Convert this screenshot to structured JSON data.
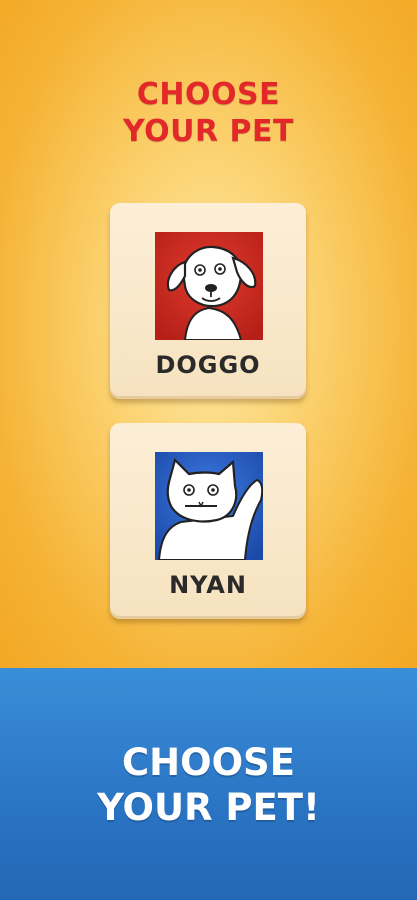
{
  "header": {
    "title_line1": "CHOOSE",
    "title_line2": "YOUR PET"
  },
  "pets": [
    {
      "label": "DOGGO",
      "icon": "dog-icon",
      "bg_color": "#d42a1e"
    },
    {
      "label": "NYAN",
      "icon": "cat-icon",
      "bg_color": "#2a63c8"
    }
  ],
  "banner": {
    "line1": "CHOOSE",
    "line2": "YOUR PET!"
  },
  "colors": {
    "title": "#e3282a",
    "background_top": "#f5b335",
    "background_bottom": "#2a74c4",
    "card": "#fcefd7"
  }
}
